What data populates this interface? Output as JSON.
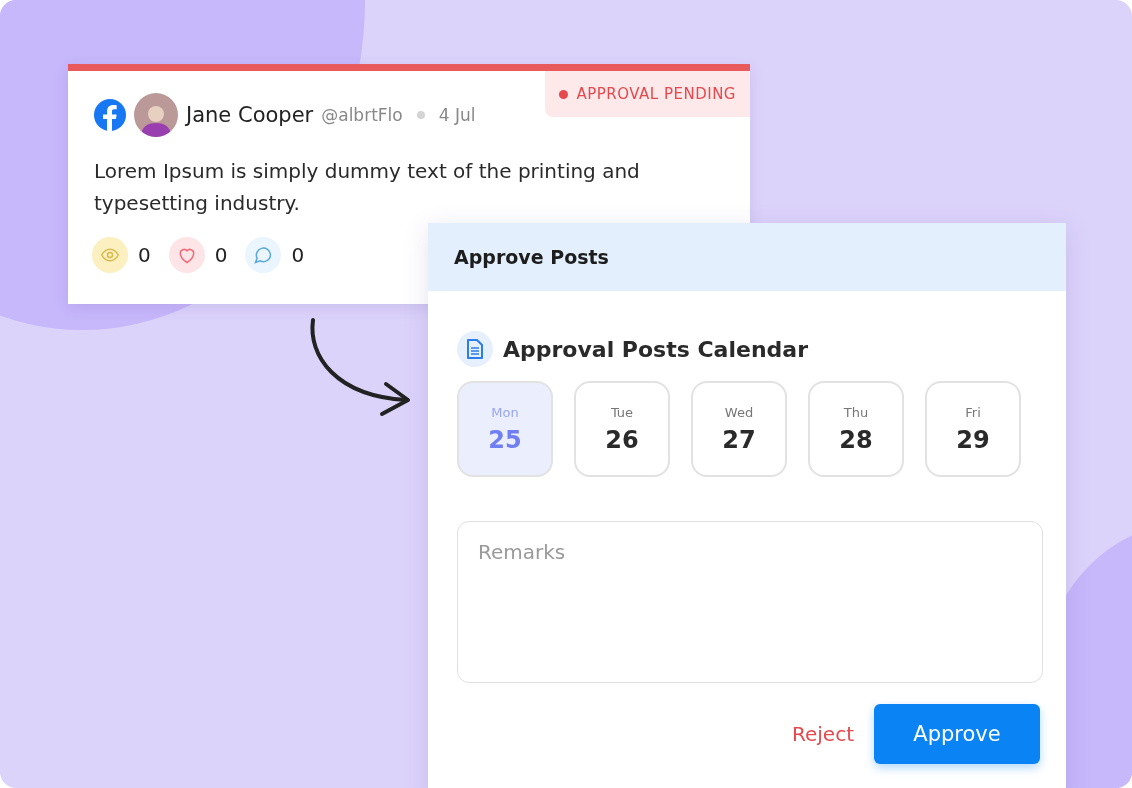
{
  "post": {
    "author": "Jane Cooper",
    "handle": "@albrtFlo",
    "date": "4 Jul",
    "status": "APPROVAL PENDING",
    "text": "Lorem Ipsum is simply dummy text of the printing and typesetting industry.",
    "stats": [
      {
        "kind": "views",
        "count": "0"
      },
      {
        "kind": "likes",
        "count": "0"
      },
      {
        "kind": "comments",
        "count": "0"
      }
    ]
  },
  "panel": {
    "title": "Approve Posts",
    "calendar_title": "Approval Posts Calendar",
    "days": [
      {
        "weekday": "Mon",
        "date": "25",
        "selected": true
      },
      {
        "weekday": "Tue",
        "date": "26",
        "selected": false
      },
      {
        "weekday": "Wed",
        "date": "27",
        "selected": false
      },
      {
        "weekday": "Thu",
        "date": "28",
        "selected": false
      },
      {
        "weekday": "Fri",
        "date": "29",
        "selected": false
      }
    ],
    "remarks": {
      "placeholder": "Remarks"
    },
    "buttons": {
      "reject": "Reject",
      "approve": "Approve"
    }
  }
}
